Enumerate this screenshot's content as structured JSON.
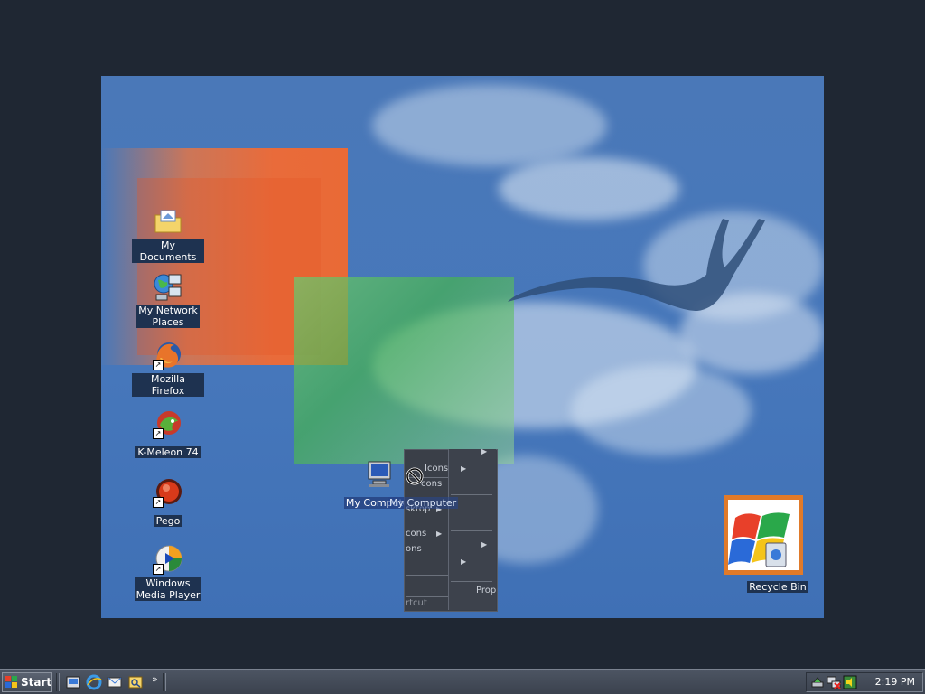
{
  "desktop": {
    "icons": [
      {
        "label": "My Documents",
        "icon": "folder-documents-icon"
      },
      {
        "label": "My Network\nPlaces",
        "icon": "network-places-icon"
      },
      {
        "label": "Mozilla Firefox",
        "icon": "firefox-icon"
      },
      {
        "label": "K-Meleon 74",
        "icon": "kmeleon-icon"
      },
      {
        "label": "Pego",
        "icon": "pego-icon"
      },
      {
        "label": "Windows\nMedia Player",
        "icon": "media-player-icon"
      }
    ],
    "my_computer": {
      "label": "My Computer",
      "drag_label": "My Computer",
      "icon": "computer-icon"
    },
    "recycle_bin": {
      "label": "Recycle Bin",
      "icon": "recycle-bin-icon"
    }
  },
  "context_menu": {
    "items": [
      "Icons",
      "cons",
      "sktop",
      "cons",
      "ons",
      "Prop",
      "rtcut"
    ]
  },
  "taskbar": {
    "start_label": "Start",
    "chevron": "»",
    "clock": "2:19 PM"
  },
  "colors": {
    "wallpaper_blue": "#4677bb",
    "orange": "#e96a36",
    "green": "#4fb85a",
    "taskbar": "#3a414d",
    "recycle_highlight": "#e07a2a"
  }
}
